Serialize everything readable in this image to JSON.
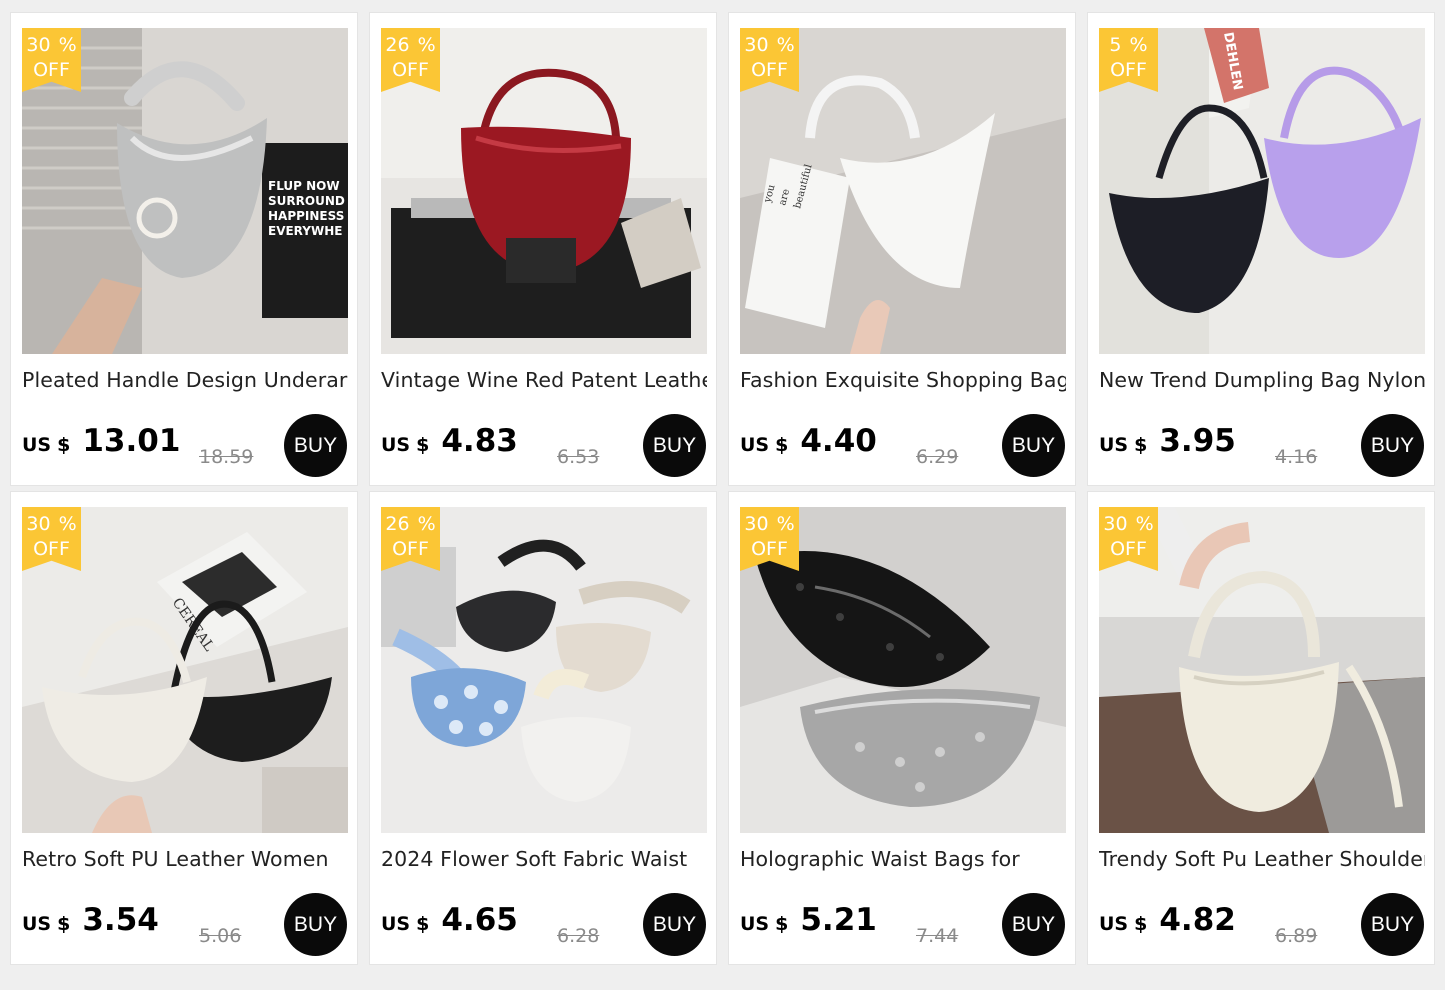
{
  "products": [
    {
      "pct": "30",
      "pct_sign": "%",
      "off": "OFF",
      "title": "Pleated Handle Design Underarm",
      "currency": "US",
      "dollar": "$",
      "price": "13.01",
      "old_price": "18.59",
      "buy": "BUY"
    },
    {
      "pct": "26",
      "pct_sign": "%",
      "off": "OFF",
      "title": "Vintage Wine Red Patent Leather",
      "currency": "US",
      "dollar": "$",
      "price": "4.83",
      "old_price": "6.53",
      "buy": "BUY"
    },
    {
      "pct": "30",
      "pct_sign": "%",
      "off": "OFF",
      "title": "Fashion Exquisite Shopping Bag",
      "currency": "US",
      "dollar": "$",
      "price": "4.40",
      "old_price": "6.29",
      "buy": "BUY"
    },
    {
      "pct": "5",
      "pct_sign": "%",
      "off": "OFF",
      "title": "New Trend Dumpling Bag Nylon",
      "currency": "US",
      "dollar": "$",
      "price": "3.95",
      "old_price": "4.16",
      "buy": "BUY"
    },
    {
      "pct": "30",
      "pct_sign": "%",
      "off": "OFF",
      "title": "Retro Soft PU Leather Women",
      "currency": "US",
      "dollar": "$",
      "price": "3.54",
      "old_price": "5.06",
      "buy": "BUY"
    },
    {
      "pct": "26",
      "pct_sign": "%",
      "off": "OFF",
      "title": "2024 Flower Soft Fabric Waist",
      "currency": "US",
      "dollar": "$",
      "price": "4.65",
      "old_price": "6.28",
      "buy": "BUY"
    },
    {
      "pct": "30",
      "pct_sign": "%",
      "off": "OFF",
      "title": "Holographic Waist Bags for",
      "currency": "US",
      "dollar": "$",
      "price": "5.21",
      "old_price": "7.44",
      "buy": "BUY"
    },
    {
      "pct": "30",
      "pct_sign": "%",
      "off": "OFF",
      "title": "Trendy Soft Pu Leather Shoulder",
      "currency": "US",
      "dollar": "$",
      "price": "4.82",
      "old_price": "6.89",
      "buy": "BUY"
    }
  ],
  "image_texts": {
    "poster_lines": [
      "FLUP NOW",
      "SURROUND",
      "HAPPINESS",
      "EVERYWHE"
    ],
    "card_lines": [
      "you",
      "are",
      "beautiful"
    ],
    "box_text": "DEHLEN",
    "magazine_text": "CEREAL"
  },
  "colors": {
    "badge": "#fbc635",
    "buy_button": "#0a0a0a",
    "strike": "#8a8a8a"
  }
}
